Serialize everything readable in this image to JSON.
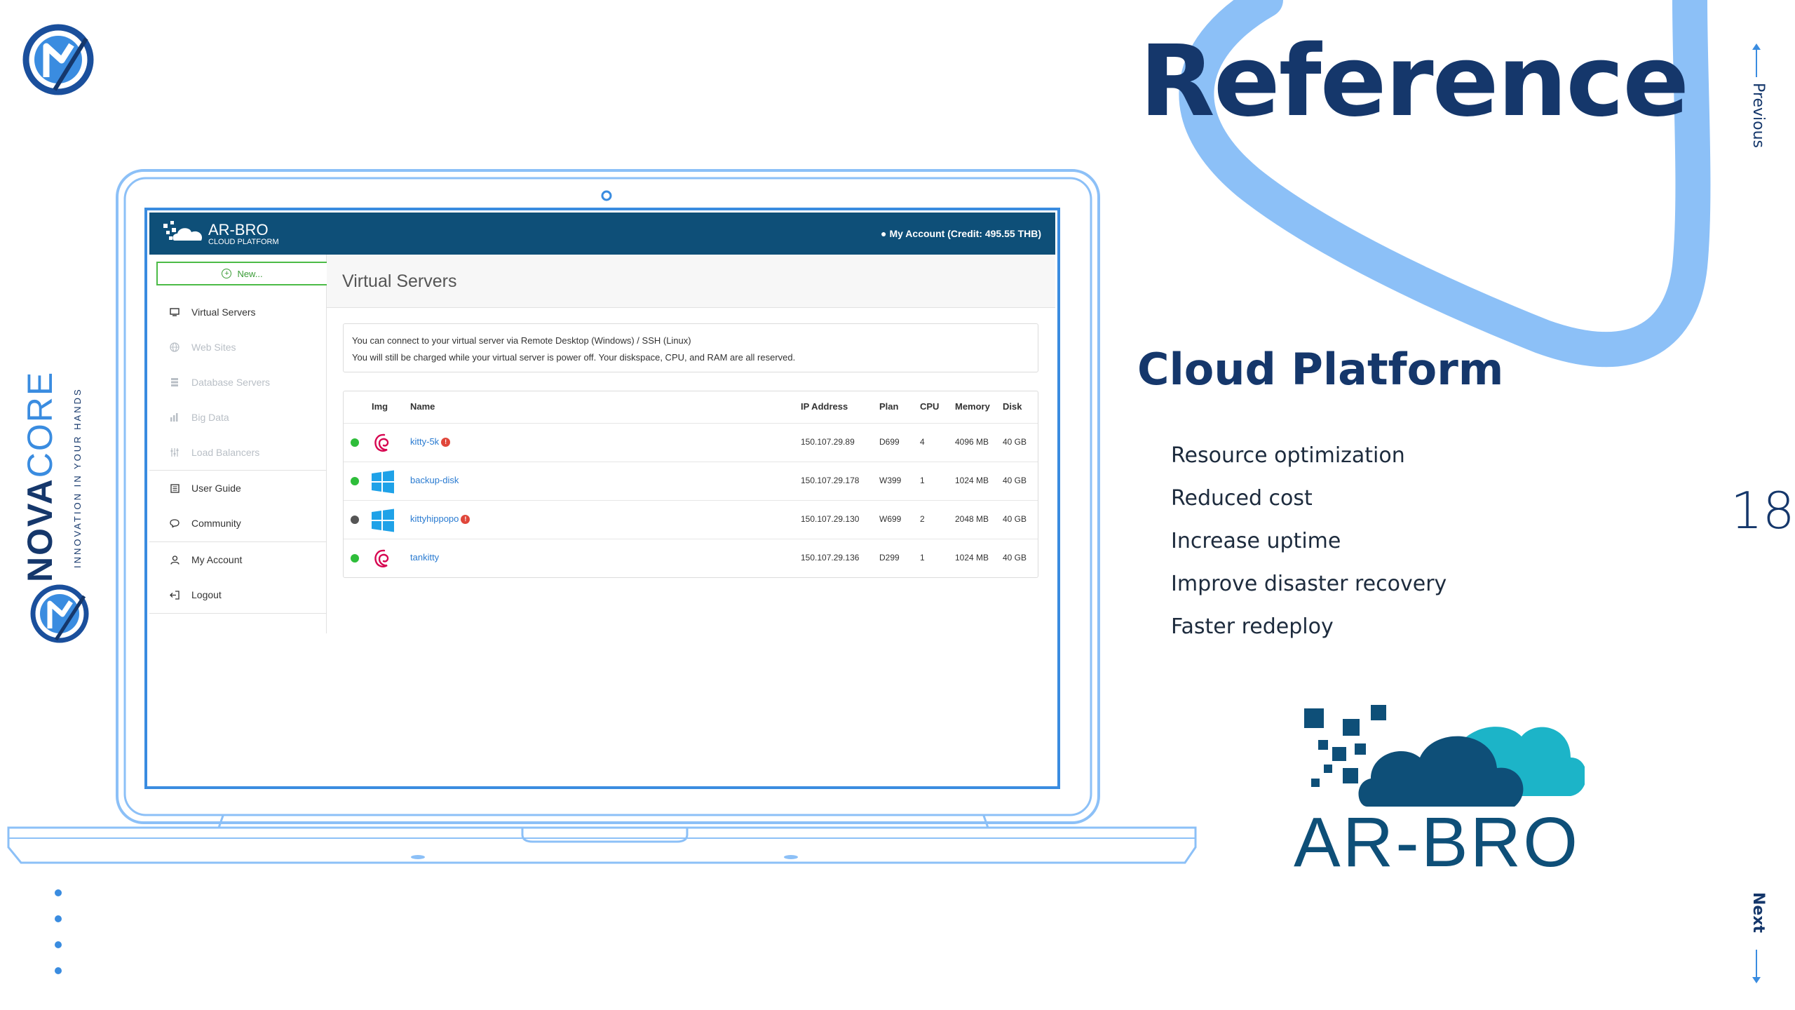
{
  "slide": {
    "title": "Reference",
    "subtitle": "Cloud Platform",
    "features": [
      "Resource optimization",
      "Reduced cost",
      "Increase uptime",
      "Improve disaster recovery",
      "Faster redeploy"
    ],
    "page_number": "18",
    "nav_previous": "Previous",
    "nav_next": "Next",
    "brand_nova": "NOVA",
    "brand_core": "CORE",
    "brand_tagline": "INNOVATION IN YOUR HANDS",
    "arbro_logo_text": "AR-BRO",
    "colors": {
      "navy": "#15376b",
      "accent_blue": "#3a8ce0",
      "ribbon": "#8cc0f7",
      "teal": "#1cb4c8",
      "arbro_navy": "#0e4f78"
    }
  },
  "app": {
    "brand_name": "AR-BRO",
    "brand_sub": "CLOUD PLATFORM",
    "account_label": "My Account (Credit: 495.55 THB)",
    "new_button": "New...",
    "page_title": "Virtual Servers",
    "sidebar": [
      {
        "label": "Virtual Servers",
        "icon": "monitor-icon",
        "enabled": true
      },
      {
        "label": "Web Sites",
        "icon": "globe-icon",
        "enabled": false
      },
      {
        "label": "Database Servers",
        "icon": "database-icon",
        "enabled": false
      },
      {
        "label": "Big Data",
        "icon": "bar-chart-icon",
        "enabled": false
      },
      {
        "label": "Load Balancers",
        "icon": "sliders-icon",
        "enabled": false
      },
      {
        "label": "User Guide",
        "icon": "book-icon",
        "enabled": true
      },
      {
        "label": "Community",
        "icon": "chat-icon",
        "enabled": true
      },
      {
        "label": "My Account",
        "icon": "user-icon",
        "enabled": true
      },
      {
        "label": "Logout",
        "icon": "logout-icon",
        "enabled": true
      }
    ],
    "notice_lines": [
      "You can connect to your virtual server via Remote Desktop (Windows) / SSH (Linux)",
      "You will still be charged while your virtual server is power off. Your diskspace, CPU, and RAM are all reserved."
    ],
    "table": {
      "headers": {
        "img": "Img",
        "name": "Name",
        "ip": "IP Address",
        "plan": "Plan",
        "cpu": "CPU",
        "memory": "Memory",
        "disk": "Disk"
      },
      "rows": [
        {
          "status": "running",
          "status_color": "#2ebd3a",
          "os": "debian-icon",
          "name": "kitty-5k",
          "warning": true,
          "ip": "150.107.29.89",
          "plan": "D699",
          "cpu": "4",
          "memory": "4096 MB",
          "disk": "40 GB"
        },
        {
          "status": "running",
          "status_color": "#2ebd3a",
          "os": "windows-icon",
          "name": "backup-disk",
          "warning": false,
          "ip": "150.107.29.178",
          "plan": "W399",
          "cpu": "1",
          "memory": "1024 MB",
          "disk": "40 GB"
        },
        {
          "status": "stopped",
          "status_color": "#555555",
          "os": "windows-icon",
          "name": "kittyhippopo",
          "warning": true,
          "ip": "150.107.29.130",
          "plan": "W699",
          "cpu": "2",
          "memory": "2048 MB",
          "disk": "40 GB"
        },
        {
          "status": "running",
          "status_color": "#2ebd3a",
          "os": "debian-icon",
          "name": "tankitty",
          "warning": false,
          "ip": "150.107.29.136",
          "plan": "D299",
          "cpu": "1",
          "memory": "1024 MB",
          "disk": "40 GB"
        }
      ]
    }
  }
}
